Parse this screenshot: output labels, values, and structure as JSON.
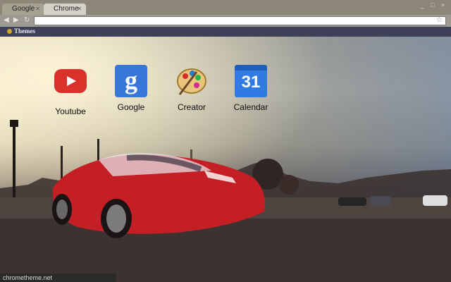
{
  "tabs": [
    {
      "label": "Google"
    },
    {
      "label": "Chrome"
    }
  ],
  "window_controls": {
    "minimize": "_",
    "maximize": "□",
    "close": "×"
  },
  "toolbar": {
    "back": "◀",
    "forward": "▶",
    "reload": "↻",
    "omnibox_value": "",
    "star": "☆"
  },
  "bookmarks": [
    {
      "label": "Themes"
    }
  ],
  "apps": [
    {
      "label": "Youtube"
    },
    {
      "label": "Google",
      "glyph": "g"
    },
    {
      "label": "Creator"
    },
    {
      "label": "Calendar",
      "glyph": "31"
    }
  ],
  "status_url": "chrometheme.net",
  "icon_names": [
    "tab-close-icon",
    "back-icon",
    "forward-icon",
    "reload-icon",
    "star-icon",
    "themes-icon",
    "youtube-icon",
    "google-icon",
    "creator-palette-icon",
    "calendar-icon"
  ]
}
